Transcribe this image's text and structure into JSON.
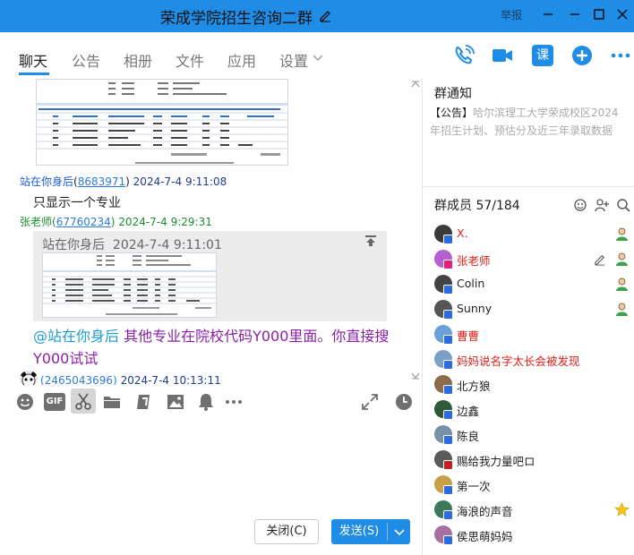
{
  "window": {
    "title": "荣成学院招生咨询二群",
    "report_label": "举报"
  },
  "tabs": [
    {
      "label": "聊天",
      "active": true
    },
    {
      "label": "公告"
    },
    {
      "label": "相册"
    },
    {
      "label": "文件"
    },
    {
      "label": "应用"
    },
    {
      "label": "设置"
    }
  ],
  "header_icons": [
    "phone-icon",
    "video-icon",
    "class-icon",
    "add-icon",
    "more-icon"
  ],
  "header_class_label": "课",
  "chat": {
    "messages": [
      {
        "sender": "站在你身后",
        "uid": "8683971",
        "time": "2024-7-4 9:11:08",
        "text": "只显示一个专业"
      },
      {
        "sender": "张老师",
        "uid": "67760234",
        "time": "2024-7-4 9:29:31",
        "quote": {
          "sender": "站在你身后",
          "time": "2024-7-4 9:11:01"
        },
        "mention": "@站在你身后",
        "text": " 其他专业在院校代码Y000里面。你直接搜Y000试试"
      },
      {
        "uid": "2465043696",
        "time": "2024-7-4 10:13:11"
      }
    ]
  },
  "toolbar_icons": [
    "emoji-icon",
    "gif-icon",
    "scissors-icon",
    "folder-icon",
    "doc-icon",
    "image-icon",
    "bell-icon",
    "more-icon",
    "expand-icon",
    "clock-icon"
  ],
  "toolbar_gif_label": "GIF",
  "composer": {
    "close_label": "关闭(C)",
    "send_label": "发送(S)"
  },
  "notice": {
    "title": "群通知",
    "tag": "【公告】",
    "body": "哈尔滨理工大学荣成校区2024年招生计划、预估分及近三年录取数据"
  },
  "members": {
    "title": "群成员 57/184",
    "list": [
      {
        "name": "X.",
        "red": true,
        "right_icon": "member-icon"
      },
      {
        "name": "张老师",
        "red": true,
        "right_icon": "member-icon"
      },
      {
        "name": "Colin",
        "right_icon": "member-icon"
      },
      {
        "name": "Sunny",
        "right_icon": "member-icon"
      },
      {
        "name": "曹曹",
        "red": true
      },
      {
        "name": "妈妈说名字太长会被发现",
        "red": true
      },
      {
        "name": "北方狼"
      },
      {
        "name": "边鑫"
      },
      {
        "name": "陈良"
      },
      {
        "name": "赐给我力量吧ロ"
      },
      {
        "name": "第一次"
      },
      {
        "name": "海浪的声音",
        "right_icon": "star-icon"
      },
      {
        "name": "侯思萌妈妈"
      }
    ]
  },
  "colors": {
    "accent": "#1f8de6",
    "admin_red": "#e0201b",
    "mention_blue": "#1d9bd0",
    "reply_purple": "#8a1fa8"
  }
}
